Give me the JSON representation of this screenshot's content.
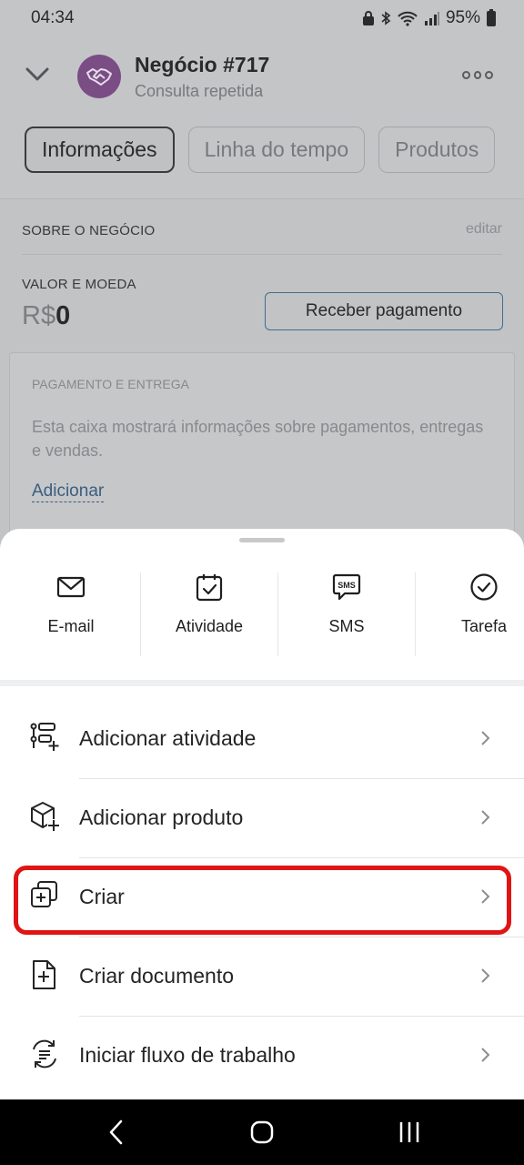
{
  "status_bar": {
    "time": "04:34",
    "battery": "95%"
  },
  "header": {
    "title": "Negócio #717",
    "subtitle": "Consulta repetida"
  },
  "tabs": [
    {
      "label": "Informações"
    },
    {
      "label": "Linha do tempo"
    },
    {
      "label": "Produtos"
    }
  ],
  "about": {
    "section_title": "SOBRE O NEGÓCIO",
    "edit_label": "editar",
    "value_label": "VALOR E MOEDA",
    "currency": "R$",
    "amount": "0",
    "receive_payment_label": "Receber pagamento"
  },
  "payment_box": {
    "title": "PAGAMENTO E ENTREGA",
    "description": "Esta caixa mostrará informações sobre pagamentos, entregas e vendas.",
    "add_label": "Adicionar"
  },
  "quick_actions": [
    {
      "label": "E-mail",
      "icon": "mail-icon"
    },
    {
      "label": "Atividade",
      "icon": "activity-checkbox-icon"
    },
    {
      "label": "SMS",
      "icon": "sms-icon"
    },
    {
      "label": "Tarefa",
      "icon": "task-check-icon"
    }
  ],
  "menu_items": [
    {
      "label": "Adicionar atividade",
      "icon": "add-activity-icon"
    },
    {
      "label": "Adicionar produto",
      "icon": "add-product-icon"
    },
    {
      "label": "Criar",
      "icon": "create-copy-icon"
    },
    {
      "label": "Criar documento",
      "icon": "create-document-icon"
    },
    {
      "label": "Iniciar fluxo de trabalho",
      "icon": "workflow-icon"
    }
  ],
  "colors": {
    "highlight": "#e01414",
    "avatar": "#7a4d85",
    "accent_link": "#3a5e80"
  }
}
